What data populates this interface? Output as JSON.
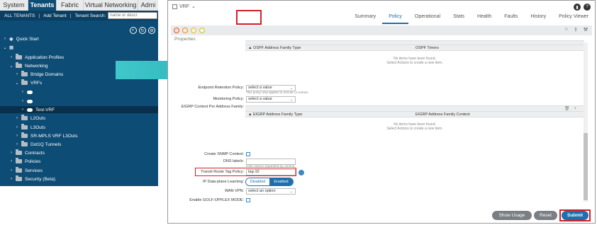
{
  "nav": {
    "tabs": [
      "System",
      "Tenants",
      "Fabric",
      "Virtual Networking",
      "Admi"
    ],
    "active_tab": "Tenants"
  },
  "subbar": {
    "all_tenants": "ALL TENANTS",
    "add_tenant": "Add Tenant",
    "search_label": "Tenant Search:",
    "search_placeholder": "name or descr"
  },
  "tree": [
    {
      "label": "Quick Start",
      "icon": "quick-start-icon"
    },
    {
      "label": "",
      "icon": "tenant-grid-icon"
    },
    {
      "label": "Application Profiles",
      "icon": "folder-icon"
    },
    {
      "label": "Networking",
      "icon": "folder-icon"
    },
    {
      "label": "Bridge Domains",
      "icon": "folder-icon"
    },
    {
      "label": "VRFs",
      "icon": "folder-icon"
    },
    {
      "label": "",
      "icon": "cloud-icon"
    },
    {
      "label": "",
      "icon": "cloud-icon"
    },
    {
      "label": "Test-VRF",
      "icon": "cloud-icon"
    },
    {
      "label": "L2Outs",
      "icon": "folder-icon"
    },
    {
      "label": "L3Outs",
      "icon": "folder-icon"
    },
    {
      "label": "SR-MPLS VRF L3Outs",
      "icon": "folder-icon"
    },
    {
      "label": "Dot1Q Tunnels",
      "icon": "folder-icon"
    },
    {
      "label": "Contracts",
      "icon": "folder-icon"
    },
    {
      "label": "Policies",
      "icon": "folder-icon"
    },
    {
      "label": "Services",
      "icon": "folder-icon"
    },
    {
      "label": "Security (Beta)",
      "icon": "folder-icon"
    }
  ],
  "vrf_panel": {
    "title": "VRF",
    "tabs": [
      "Summary",
      "Policy",
      "Operational",
      "Stats",
      "Health",
      "Faults",
      "History",
      "Policy Viewer"
    ],
    "active_tab": "Policy",
    "properties_label": "Properties",
    "ospf": {
      "col1": "OSPF Address Family Type",
      "col2": "OSPF Timers",
      "empty1": "No items have been found.",
      "empty2": "Select Actions to create a new item."
    },
    "endpoint_retention": {
      "label": "Endpoint Retention Policy:",
      "value": "select a value",
      "hint": "This policy only applies to remote L3 entries"
    },
    "monitoring": {
      "label": "Monitoring Policy:",
      "value": "select a value"
    },
    "eigrp_label": "EIGRP Context Per Address Family:",
    "eigrp": {
      "col1": "EIGRP Address Family Type",
      "col2": "EIGRP Address Family Context",
      "empty1": "No items have been found.",
      "empty2": "Select Actions to create a new item."
    },
    "create_snmp": {
      "label": "Create SNMP Context:"
    },
    "dns_labels": {
      "label": "DNS labels:",
      "hint": "enter names separated by comma"
    },
    "transit_route": {
      "label": "Transit Route Tag Policy:",
      "value": "tag-10"
    },
    "ip_learning": {
      "label": "IP Data-plane Learning:",
      "off": "Disabled",
      "on": "Enabled"
    },
    "wan_vpn": {
      "label": "WAN VPN:",
      "value": "select an option"
    },
    "golf": {
      "label": "Enable GOLF-OPFLEX MODE:"
    },
    "buttons": {
      "show_usage": "Show Usage",
      "reset": "Reset",
      "submit": "Submit"
    }
  }
}
